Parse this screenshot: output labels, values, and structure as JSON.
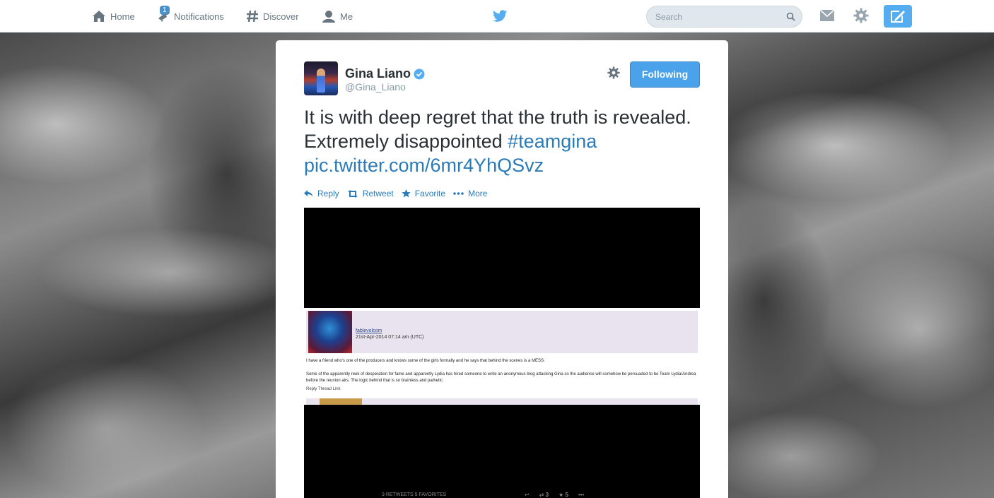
{
  "nav": {
    "home_label": "Home",
    "notifications_label": "Notifications",
    "notifications_badge": "1",
    "discover_label": "Discover",
    "me_label": "Me"
  },
  "search": {
    "placeholder": "Search"
  },
  "tweet": {
    "name": "Gina Liano",
    "handle": "@Gina_Liano",
    "follow_label": "Following",
    "text_plain": "It is with deep regret that the truth is revealed. Extremely disappointed ",
    "hashtag": "#teamgina",
    "pic_link": "pic.twitter.com/6mr4YhQSvz",
    "actions": {
      "reply": "Reply",
      "retweet": "Retweet",
      "favorite": "Favorite",
      "more": "More"
    }
  },
  "media": {
    "user": "fablevolcom",
    "date": "21st-Apr-2014 07:14 am (UTC)",
    "line1": "I have a friend who's one of the producers and knows some of the girls formally and he says that behind the scenes is a MESS.",
    "para": "Some of the apparently reek of desperation for fame and apparently Lydia has hired someone to write an anonymous blog attacking Gina so the audience will somehow be persuaded to be Team Lydia/Andrea before the reunion airs. The logic behind that is so brainless and pathetic.",
    "links": "Reply  Thread  Link",
    "footer_counts": "3 RETWEETS  5 FAVORITES",
    "footer_retweets": "3",
    "footer_favorites": "5"
  },
  "colors": {
    "accent": "#55acee",
    "link": "#2b7bb9",
    "follow_button": "#4aa3ea"
  },
  "icons": [
    "home-icon",
    "notifications-icon",
    "discover-icon",
    "me-icon",
    "twitter-bird-icon",
    "search-icon",
    "messages-icon",
    "settings-icon",
    "compose-icon",
    "verified-icon",
    "reply-icon",
    "retweet-icon",
    "favorite-icon",
    "more-icon"
  ]
}
